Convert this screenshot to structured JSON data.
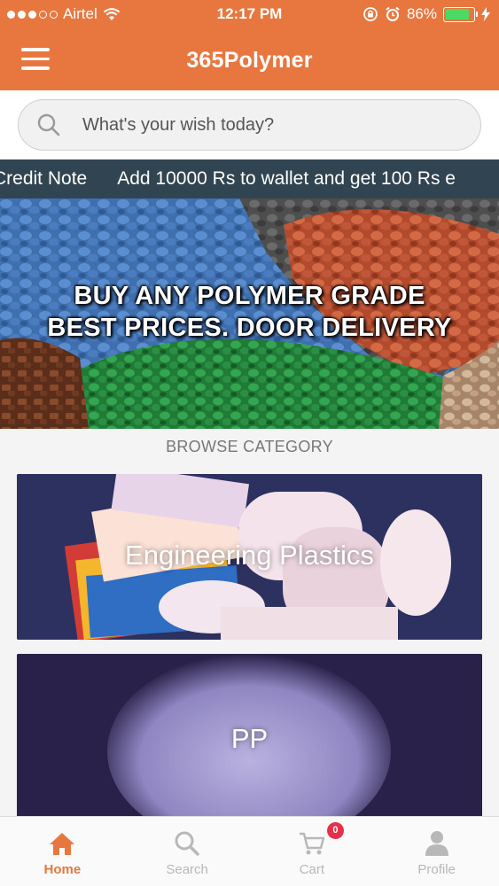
{
  "status_bar": {
    "carrier": "Airtel",
    "time": "12:17 PM",
    "battery": "86%",
    "battery_level": 0.86
  },
  "header": {
    "title": "365Polymer",
    "menu_icon": "hamburger-menu-icon"
  },
  "search": {
    "placeholder": "What's your wish today?",
    "icon": "search-icon"
  },
  "marquee": {
    "items": [
      "Credit Note",
      "Add 10000 Rs to wallet and get 100 Rs e"
    ]
  },
  "banner": {
    "line1": "BUY ANY POLYMER GRADE",
    "line2": "BEST PRICES. DOOR DELIVERY"
  },
  "browse": {
    "label": "BROWSE CATEGORY",
    "categories": [
      {
        "name": "Engineering Plastics"
      },
      {
        "name": "PP"
      }
    ]
  },
  "tabs": [
    {
      "label": "Home",
      "icon": "home-icon",
      "active": true
    },
    {
      "label": "Search",
      "icon": "search-icon",
      "active": false
    },
    {
      "label": "Cart",
      "icon": "cart-icon",
      "active": false,
      "badge": "0"
    },
    {
      "label": "Profile",
      "icon": "profile-icon",
      "active": false
    }
  ],
  "colors": {
    "brand": "#e8773f",
    "marquee_bg": "#314451",
    "badge": "#e5304a",
    "tab_inactive": "#b8b8b8"
  }
}
